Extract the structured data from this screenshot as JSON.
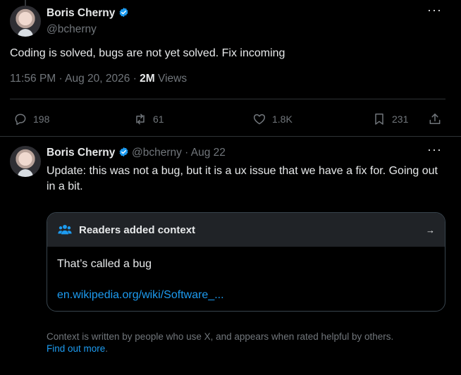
{
  "colors": {
    "background": "#000000",
    "text": "#e7e9ea",
    "muted": "#71767b",
    "link": "#1d9bf0",
    "verified": "#1d9bf0"
  },
  "tweet": {
    "author_name": "Boris Cherny",
    "handle": "@bcherny",
    "text": "Coding is solved, bugs are not yet solved. Fix incoming",
    "time": "11:56 PM",
    "sep1": "·",
    "date": "Aug 20, 2026",
    "sep2": "·",
    "views_count": "2M",
    "views_label": "Views",
    "more_icon": "more-dots-icon",
    "actions": {
      "replies": "198",
      "reposts": "61",
      "likes": "1.8K",
      "bookmarks": "231"
    }
  },
  "reply": {
    "author_name": "Boris Cherny",
    "handle": "@bcherny",
    "sep": "·",
    "date": "Aug 22",
    "text": "Update: this was not a bug, but it is a ux issue that we have a fix for. Going out in a bit."
  },
  "community_note": {
    "header": "Readers added context",
    "arrow": "→",
    "text": "That’s called a bug",
    "link": "en.wikipedia.org/wiki/Software_..."
  },
  "footer": {
    "text": "Context is written by people who use X, and appears when rated helpful by others.",
    "link": "Find out more",
    "link_suffix": "."
  }
}
